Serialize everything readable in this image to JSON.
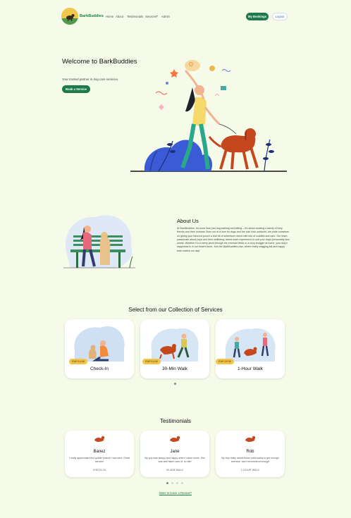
{
  "nav": {
    "brand": "BarkBuddies",
    "links": [
      "Home",
      "About",
      "Testimonials",
      "Services",
      "Admin"
    ],
    "services_caret": "▾",
    "my_bookings": "My Bookings",
    "logout": "Logout"
  },
  "hero": {
    "title": "Welcome to BarkBuddies",
    "subtitle": "Your trusted partner in dog care services.",
    "cta": "Book a Service"
  },
  "about": {
    "title": "About Us",
    "text": "At BarkBuddies, it's more than just dog walking and sitting – it's about creating a family of furry friends and their humans. Born out of a love for dogs and the lush Irish outdoors, we pride ourselves on giving your beloved pooch a real bit of adventure mixed with lots of cuddles and care. Our team, passionate about pups and their wellbeing, tailors each experience to suit your dog's personality and needs. Whether it's a merry jaunt through the emerald fields or a cozy snuggle at home, your dog's happiness is in our heart's work. Join the BarkBuddies clan, where every wagging tail and happy bark makes our day!"
  },
  "services": {
    "title": "Select from our Collection of Services",
    "items": [
      {
        "name": "Check-In",
        "price": "EUR 10.00"
      },
      {
        "name": "30-Min Walk",
        "price": "EUR 10.00"
      },
      {
        "name": "1-Hour Walk",
        "price": "EUR 20.00"
      }
    ]
  },
  "testimonials": {
    "title": "Testimonials",
    "items": [
      {
        "name": "Banez",
        "text": "I really appreciated the update picture I was sent. Great service!",
        "service": "CHECK-IN"
      },
      {
        "name": "Jane",
        "text": "My pup was sleepy and happy when I came home. She was well taken care of, so fab!",
        "service": "30-MIN WALK"
      },
      {
        "name": "Rob",
        "text": "My boy really needs these extra walks to get enough exercise, can't recommend enough",
        "service": "1-HOUR WALK"
      }
    ],
    "review_link": "Want to leave a Review?"
  },
  "colors": {
    "background": "#f6fbe9",
    "primary_green": "#1e7a4a",
    "price_yellow": "#f2c54a",
    "link_blue": "#2f6fbd"
  }
}
